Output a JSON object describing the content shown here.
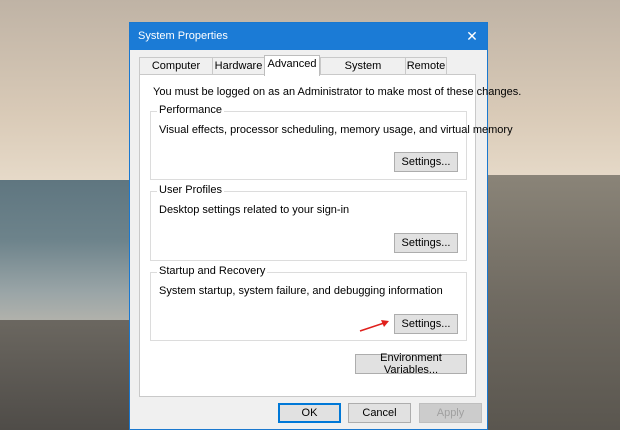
{
  "window": {
    "title": "System Properties",
    "close_symbol": "✕"
  },
  "tabs": [
    {
      "label": "Computer Name",
      "active": false
    },
    {
      "label": "Hardware",
      "active": false
    },
    {
      "label": "Advanced",
      "active": true
    },
    {
      "label": "System Protection",
      "active": false
    },
    {
      "label": "Remote",
      "active": false
    }
  ],
  "advanced": {
    "admin_note": "You must be logged on as an Administrator to make most of these changes.",
    "performance": {
      "title": "Performance",
      "description": "Visual effects, processor scheduling, memory usage, and virtual memory",
      "button": "Settings..."
    },
    "user_profiles": {
      "title": "User Profiles",
      "description": "Desktop settings related to your sign-in",
      "button": "Settings..."
    },
    "startup_recovery": {
      "title": "Startup and Recovery",
      "description": "System startup, system failure, and debugging information",
      "button": "Settings..."
    },
    "env_button": "Environment Variables..."
  },
  "footer": {
    "ok": "OK",
    "cancel": "Cancel",
    "apply": "Apply"
  },
  "colors": {
    "titlebar": "#1b7bd6",
    "annotation_arrow": "#e0201c",
    "focus_border": "#0078d7"
  },
  "annotation": {
    "icon": "red-arrow-icon"
  }
}
